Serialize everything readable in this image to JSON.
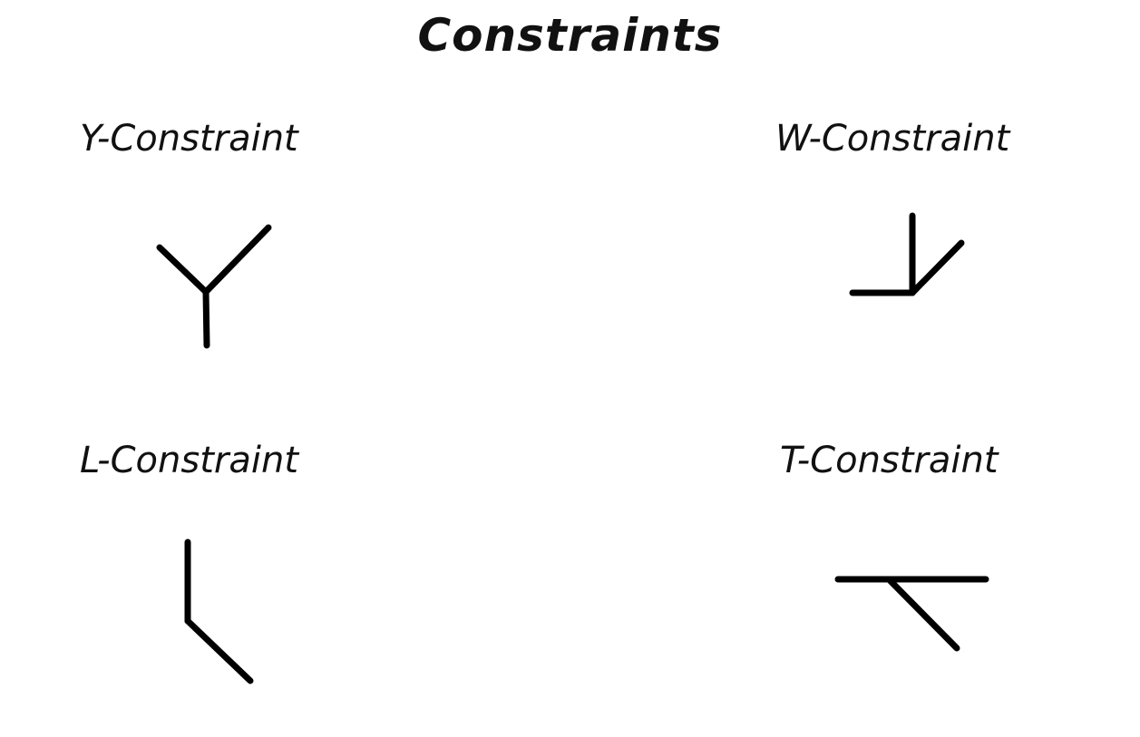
{
  "title": "Constraints",
  "constraints": [
    {
      "id": "y",
      "label": "Y-Constraint"
    },
    {
      "id": "w",
      "label": "W-Constraint"
    },
    {
      "id": "l",
      "label": "L-Constraint"
    },
    {
      "id": "t",
      "label": "T-Constraint"
    }
  ],
  "colors": {
    "background": "#ffffff",
    "stroke": "#000000",
    "text": "#111111"
  }
}
